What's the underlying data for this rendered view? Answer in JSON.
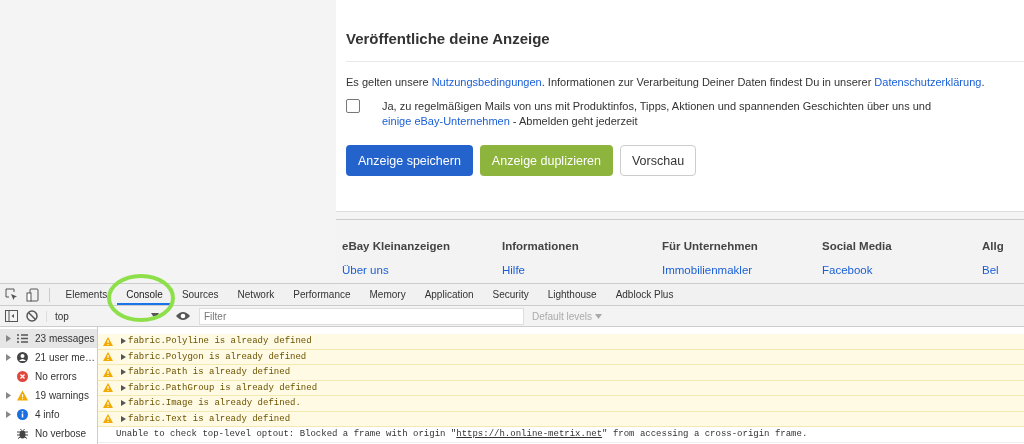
{
  "publish_card": {
    "title": "Veröffentliche deine Anzeige",
    "terms": [
      {
        "text": "Es gelten unsere ",
        "kind": "text"
      },
      {
        "text": "Nutzungsbedingungen",
        "kind": "link"
      },
      {
        "text": ". Informationen zur Verarbeitung Deiner Daten findest Du in unserer ",
        "kind": "text"
      },
      {
        "text": "Datenschutzerklärung",
        "kind": "link"
      },
      {
        "text": ".",
        "kind": "text"
      }
    ],
    "newsletter": {
      "checked": false,
      "label": [
        {
          "text": "Ja, zu regelmäßigen Mails von uns mit Produktinfos, Tipps, Aktionen und spannenden Geschichten über uns und ",
          "kind": "text"
        },
        {
          "text": "einige eBay-Unternehmen",
          "kind": "link"
        },
        {
          "text": " - Abmelden geht jederzeit",
          "kind": "text"
        }
      ]
    },
    "buttons": [
      {
        "label": "Anzeige speichern",
        "kind": "primary"
      },
      {
        "label": "Anzeige duplizieren",
        "kind": "success"
      },
      {
        "label": "Vorschau",
        "kind": "secondary"
      }
    ]
  },
  "footer": {
    "columns": [
      {
        "heading": "eBay Kleinanzeigen",
        "link": "Über uns"
      },
      {
        "heading": "Informationen",
        "link": "Hilfe"
      },
      {
        "heading": "Für Unternehmen",
        "link": "Immobilienmakler"
      },
      {
        "heading": "Social Media",
        "link": "Facebook"
      },
      {
        "heading": "Allg",
        "link": "Bel"
      }
    ]
  },
  "devtools": {
    "tabs": [
      {
        "label": "Elements",
        "selected": false
      },
      {
        "label": "Console",
        "selected": true
      },
      {
        "label": "Sources",
        "selected": false
      },
      {
        "label": "Network",
        "selected": false
      },
      {
        "label": "Performance",
        "selected": false
      },
      {
        "label": "Memory",
        "selected": false
      },
      {
        "label": "Application",
        "selected": false
      },
      {
        "label": "Security",
        "selected": false
      },
      {
        "label": "Lighthouse",
        "selected": false
      },
      {
        "label": "Adblock Plus",
        "selected": false
      }
    ],
    "context": "top",
    "filter": {
      "placeholder": "Filter"
    },
    "levels": "Default levels",
    "sidebar": [
      {
        "kind": "messages",
        "label": "23 messages",
        "selected": true
      },
      {
        "kind": "user",
        "label": "21 user me…",
        "selected": false
      },
      {
        "kind": "errors",
        "label": "No errors",
        "selected": false
      },
      {
        "kind": "warnings",
        "label": "19 warnings",
        "selected": false
      },
      {
        "kind": "info",
        "label": "4 info",
        "selected": false
      },
      {
        "kind": "verbose",
        "label": "No verbose",
        "selected": false
      }
    ],
    "messages": [
      {
        "kind": "warning",
        "parts": [
          {
            "text": "fabric.Polyline is already defined",
            "kind": "text"
          }
        ]
      },
      {
        "kind": "warning",
        "parts": [
          {
            "text": "fabric.Polygon is already defined",
            "kind": "text"
          }
        ]
      },
      {
        "kind": "warning",
        "parts": [
          {
            "text": "fabric.Path is already defined",
            "kind": "text"
          }
        ]
      },
      {
        "kind": "warning",
        "parts": [
          {
            "text": "fabric.PathGroup is already defined",
            "kind": "text"
          }
        ]
      },
      {
        "kind": "warning",
        "parts": [
          {
            "text": "fabric.Image is already defined.",
            "kind": "text"
          }
        ]
      },
      {
        "kind": "warning",
        "parts": [
          {
            "text": "fabric.Text is already defined",
            "kind": "text"
          }
        ]
      },
      {
        "kind": "log",
        "parts": [
          {
            "text": "Unable to check top-level optout: Blocked a frame with origin \"",
            "kind": "text"
          },
          {
            "text": "https://h.online-metrix.net",
            "kind": "link"
          },
          {
            "text": "\" from accessing a cross-origin frame.",
            "kind": "text"
          }
        ]
      }
    ]
  }
}
